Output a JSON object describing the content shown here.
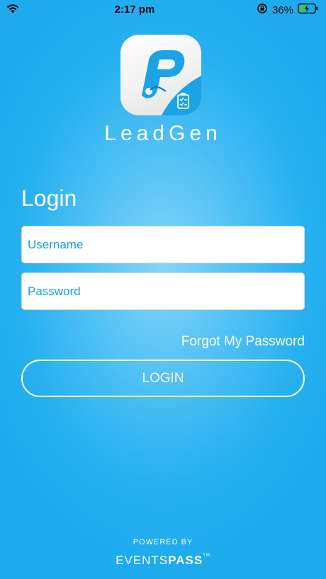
{
  "status_bar": {
    "time": "2:17 pm",
    "battery_percent": "36%",
    "icons": [
      "wifi-icon",
      "orientation-lock-icon",
      "battery-charging-icon"
    ]
  },
  "app": {
    "name": "LeadGen",
    "icon": "leadgen-app-icon"
  },
  "login": {
    "title": "Login",
    "username_placeholder": "Username",
    "username_value": "",
    "password_placeholder": "Password",
    "password_value": "",
    "forgot_password_label": "Forgot My Password",
    "login_button_label": "LOGIN"
  },
  "footer": {
    "powered_by": "POWERED BY",
    "brand_part1": "EVENTS",
    "brand_part2": "PASS",
    "brand_tm": "TM"
  },
  "colors": {
    "background": "#26b0f0",
    "background_center": "#86d4f8",
    "input_text": "#1aa0dc",
    "white": "#ffffff"
  }
}
